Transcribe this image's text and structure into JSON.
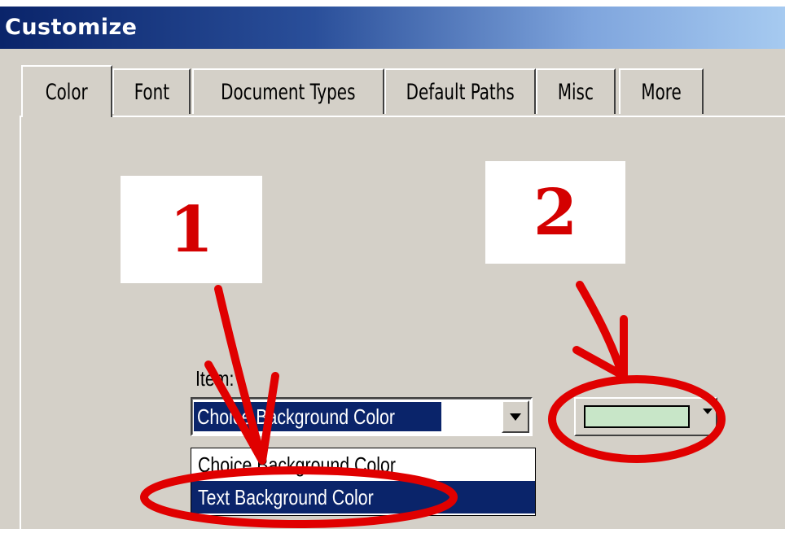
{
  "window": {
    "title": "Customize"
  },
  "tabs": [
    {
      "label": "Color",
      "active": true
    },
    {
      "label": "Font",
      "active": false
    },
    {
      "label": "Document Types",
      "active": false
    },
    {
      "label": "Default Paths",
      "active": false
    },
    {
      "label": "Misc",
      "active": false
    },
    {
      "label": "More",
      "active": false
    }
  ],
  "callouts": {
    "step1": "1",
    "step2": "2"
  },
  "item": {
    "label": "Item:",
    "selected_value": "Choice Background Color",
    "options": [
      "Choice Background Color",
      "Text Background Color"
    ],
    "highlighted_option": "Text Background Color"
  },
  "color_picker": {
    "swatch_color": "#c8e6c8"
  },
  "colors": {
    "title_bar_start": "#0a246a",
    "title_bar_end": "#a6caf0",
    "annotation_red": "#e00000",
    "dialog_face": "#d4d0c8"
  }
}
